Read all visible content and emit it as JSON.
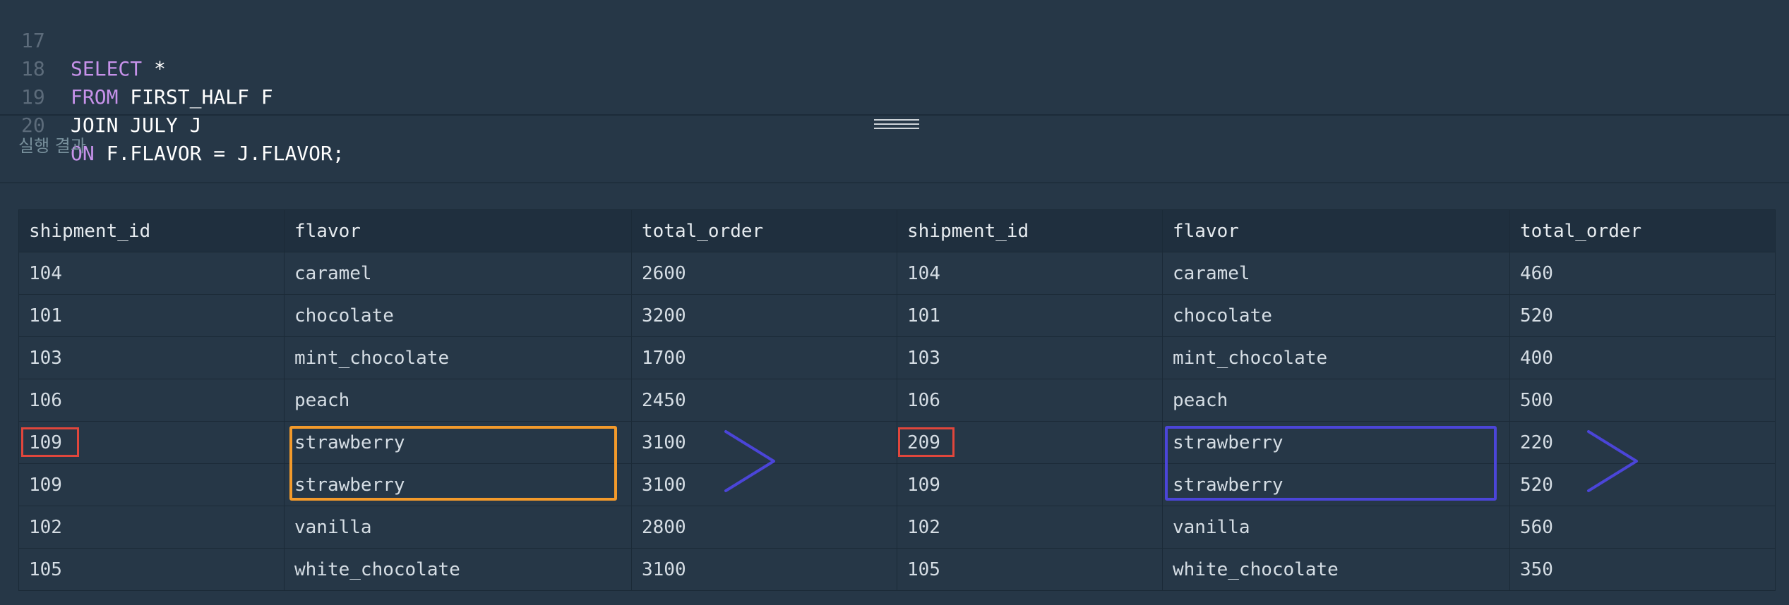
{
  "editor": {
    "lines": [
      {
        "num": "17",
        "keyword": "SELECT",
        "rest": " *"
      },
      {
        "num": "18",
        "keyword": "FROM",
        "rest": " FIRST_HALF F"
      },
      {
        "num": "19",
        "keyword": "",
        "rest": "JOIN JULY J"
      },
      {
        "num": "20",
        "keyword": "ON",
        "rest": " F.FLAVOR = J.FLAVOR;"
      }
    ]
  },
  "results": {
    "label": "실행 결과",
    "columns": [
      "shipment_id",
      "flavor",
      "total_order",
      "shipment_id",
      "flavor",
      "total_order"
    ],
    "rows": [
      [
        "104",
        "caramel",
        "2600",
        "104",
        "caramel",
        "460"
      ],
      [
        "101",
        "chocolate",
        "3200",
        "101",
        "chocolate",
        "520"
      ],
      [
        "103",
        "mint_chocolate",
        "1700",
        "103",
        "mint_chocolate",
        "400"
      ],
      [
        "106",
        "peach",
        "2450",
        "106",
        "peach",
        "500"
      ],
      [
        "109",
        "strawberry",
        "3100",
        "209",
        "strawberry",
        "220"
      ],
      [
        "109",
        "strawberry",
        "3100",
        "109",
        "strawberry",
        "520"
      ],
      [
        "102",
        "vanilla",
        "2800",
        "102",
        "vanilla",
        "560"
      ],
      [
        "105",
        "white_chocolate",
        "3100",
        "105",
        "white_chocolate",
        "350"
      ]
    ]
  },
  "annotations": {
    "red_color": "#e0463c",
    "orange_color": "#f39a2b",
    "purple_color": "#4b45d8"
  },
  "colors": {
    "background": "#263747",
    "header_bg": "#1f2f3e",
    "keyword": "#c792ea",
    "line_number": "#5c6b7a"
  }
}
